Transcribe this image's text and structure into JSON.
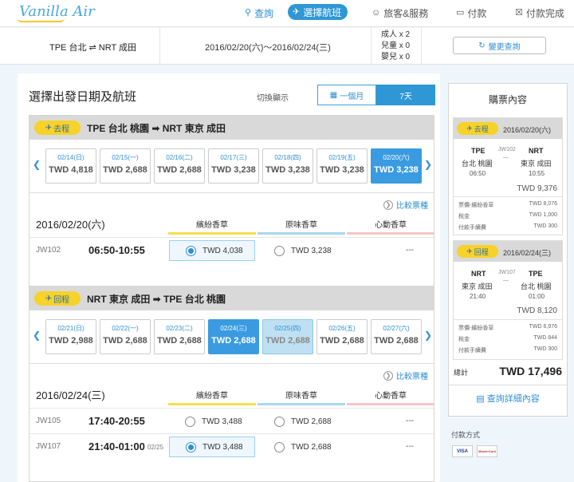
{
  "brand": "Vanilla Air",
  "nav": {
    "steps": [
      {
        "label": "查詢",
        "icon": "search-icon"
      },
      {
        "label": "選擇航班",
        "icon": "plane-icon"
      },
      {
        "label": "旅客&服務",
        "icon": "person-icon"
      },
      {
        "label": "付款",
        "icon": "card-icon"
      },
      {
        "label": "付款完成",
        "icon": "check-icon"
      }
    ]
  },
  "summary": {
    "route_from": "TPE 台北",
    "route_to": "NRT 成田",
    "dates": "2016/02/20(六)〜2016/02/24(三)",
    "pax_adult": "成人 x 2",
    "pax_child": "兒童 x 0",
    "pax_infant": "嬰兒 x 0",
    "change_label": "變更查詢"
  },
  "main": {
    "title": "選擇出發日期及航班",
    "switch_label": "切換顯示",
    "toggle_month": "一個月",
    "toggle_week": "7天",
    "compare_label": "比較票種",
    "fare_headers": [
      "繽紛香草",
      "原味香草",
      "心動香草"
    ],
    "fare_colors": [
      "#f4e04a",
      "#a9d8f0",
      "#f3c6c6"
    ]
  },
  "outbound": {
    "tag": "去程",
    "route": "TPE 台北 桃園 ➡ NRT 東京 成田",
    "days": [
      {
        "date": "02/14(日)",
        "price": "TWD 4,818"
      },
      {
        "date": "02/15(一)",
        "price": "TWD 2,688"
      },
      {
        "date": "02/16(二)",
        "price": "TWD 2,688"
      },
      {
        "date": "02/17(三)",
        "price": "TWD 3,238"
      },
      {
        "date": "02/18(四)",
        "price": "TWD 3,238"
      },
      {
        "date": "02/19(五)",
        "price": "TWD 3,238"
      },
      {
        "date": "02/20(六)",
        "price": "TWD 3,238"
      }
    ],
    "flight_date": "2016/02/20(六)",
    "flights": [
      {
        "no": "JW102",
        "time": "06:50-10:55",
        "next": "",
        "fare1": "TWD 4,038",
        "fare2": "TWD 3,238",
        "fare3": "---"
      }
    ]
  },
  "return": {
    "tag": "回程",
    "route": "NRT 東京 成田 ➡ TPE 台北 桃園",
    "days": [
      {
        "date": "02/21(日)",
        "price": "TWD 2,988"
      },
      {
        "date": "02/22(一)",
        "price": "TWD 2,688"
      },
      {
        "date": "02/23(二)",
        "price": "TWD 2,688"
      },
      {
        "date": "02/24(三)",
        "price": "TWD 2,688"
      },
      {
        "date": "02/25(四)",
        "price": "TWD 2,688"
      },
      {
        "date": "02/26(五)",
        "price": "TWD 2,688"
      },
      {
        "date": "02/27(六)",
        "price": "TWD 2,688"
      }
    ],
    "flight_date": "2016/02/24(三)",
    "flights": [
      {
        "no": "JW105",
        "time": "17:40-20:55",
        "next": "",
        "fare1": "TWD 3,488",
        "fare2": "TWD 2,688",
        "fare3": "---"
      },
      {
        "no": "JW107",
        "time": "21:40-01:00",
        "next": "02/25",
        "fare1": "TWD 3,488",
        "fare2": "TWD 2,688",
        "fare3": "---"
      }
    ]
  },
  "sidebar": {
    "title": "購票內容",
    "out": {
      "tag": "去程",
      "date": "2016/02/20(六)",
      "from_code": "TPE",
      "from_city": "台北 桃園",
      "dep": "06:50",
      "flight": "JW102",
      "to_code": "NRT",
      "to_city": "東京 成田",
      "arr": "10:55",
      "total": "TWD 9,376",
      "fees": [
        {
          "label": "票價-繽紛香草",
          "value": "TWD 8,076"
        },
        {
          "label": "稅金",
          "value": "TWD 1,000"
        },
        {
          "label": "付款手續費",
          "value": "TWD 300"
        }
      ]
    },
    "ret": {
      "tag": "回程",
      "date": "2016/02/24(三)",
      "from_code": "NRT",
      "from_city": "東京 成田",
      "dep": "21:40",
      "flight": "JW107",
      "to_code": "TPE",
      "to_city": "台北 桃園",
      "arr": "01:00",
      "total": "TWD 8,120",
      "fees": [
        {
          "label": "票價-繽紛香草",
          "value": "TWD 6,976"
        },
        {
          "label": "稅金",
          "value": "TWD 844"
        },
        {
          "label": "付款手續費",
          "value": "TWD 300"
        }
      ]
    },
    "total_label": "總計",
    "total_value": "TWD 17,496",
    "detail_label": "查詢詳細內容",
    "payment_label": "付款方式",
    "cards": [
      "VISA",
      "MasterCard"
    ]
  }
}
